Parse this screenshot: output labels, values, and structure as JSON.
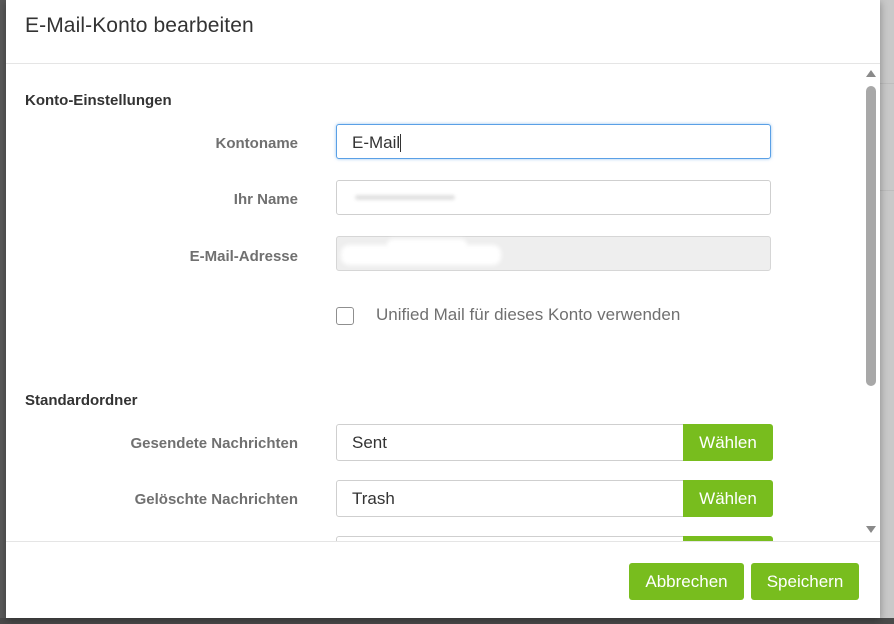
{
  "dialog": {
    "title": "E-Mail-Konto bearbeiten"
  },
  "account_settings": {
    "section_title": "Konto-Einstellungen",
    "account_name_label": "Kontoname",
    "account_name_value": "E-Mail",
    "your_name_label": "Ihr Name",
    "email_label": "E-Mail-Adresse",
    "unified_mail_label": "Unified Mail für dieses Konto verwenden",
    "unified_mail_checked": false
  },
  "default_folders": {
    "section_title": "Standardordner",
    "sent_label": "Gesendete Nachrichten",
    "sent_value": "Sent",
    "trash_label": "Gelöschte Nachrichten",
    "trash_value": "Trash",
    "choose_label": "Wählen"
  },
  "footer": {
    "cancel_label": "Abbrechen",
    "save_label": "Speichern"
  },
  "colors": {
    "accent_green": "#78bd1e",
    "focus_blue": "#5aa0e6"
  }
}
